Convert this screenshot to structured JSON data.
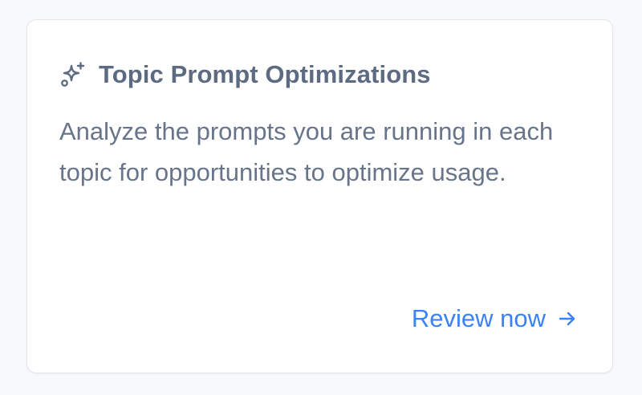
{
  "card": {
    "title": "Topic Prompt Optimizations",
    "title_icon": "sparkles-icon",
    "description": "Analyze the prompts you are running in each topic for opportunities to optimize usage.",
    "action": {
      "label": "Review now",
      "icon": "arrow-right-icon"
    }
  },
  "colors": {
    "page_background": "#f8f9fb",
    "card_background": "#ffffff",
    "card_border": "#e3e6ec",
    "title": "#5d6b82",
    "description": "#67748a",
    "link": "#3b82f6"
  }
}
